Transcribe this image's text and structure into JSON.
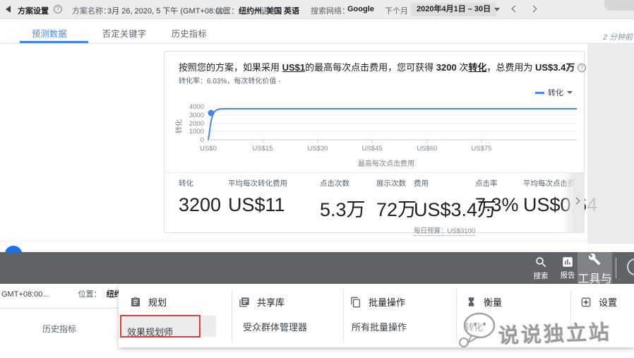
{
  "colors": {
    "accent": "#4285f4",
    "chart_line": "#4285f4",
    "annotation_red": "#e53935",
    "toolbar_bg": "#5f6368"
  },
  "glyphs": {
    "question": "?"
  },
  "topbar": {
    "title": "方案设置",
    "fields": [
      {
        "label": "方案名称：",
        "value": "3月 26, 2020, 5 下午 (GMT+08:00.."
      },
      {
        "label": "位置：",
        "value": "纽约州, 美国"
      },
      {
        "label": "语言：",
        "value": "英语"
      },
      {
        "label": "搜索网络：",
        "value": "Google"
      }
    ],
    "next_month_label": "下个月",
    "date_range": "2020年4月1日 – 30日"
  },
  "tabs": {
    "forecast": "预测数据",
    "negative": "否定关键字",
    "historical": "历史指标"
  },
  "saved_ago": "2 分钟前",
  "card": {
    "headline": [
      "按照您的方案，如果采用 ",
      "US$1",
      "的最高每次点击费用，您可获得 ",
      "3200",
      " 次",
      "转化",
      "，总费用为 ",
      "US$3.4万"
    ],
    "subline": "转化率：6.03%，每次转化价值 -",
    "legend_label": "转化",
    "chart": {
      "type": "line",
      "ylabel": "转化",
      "xlabel": "最高每次点击费用",
      "y_ticks": [
        "4000",
        "3000",
        "2000",
        "1000",
        "0"
      ],
      "x_ticks": [
        "US$0",
        "US$15",
        "US$30",
        "US$45",
        "US$60",
        "US$75"
      ],
      "series": [
        {
          "name": "转化",
          "points_max_cpc_vs_conversions": [
            [
              0,
              0
            ],
            [
              1,
              3200
            ],
            [
              3,
              3750
            ],
            [
              100,
              3750
            ]
          ]
        }
      ],
      "marker": {
        "max_cpc": "US$1",
        "conversions": 3200
      }
    },
    "metrics": [
      {
        "label": "转化",
        "value": "3200"
      },
      {
        "label": "平均每次转化费用",
        "value": "US$11"
      },
      {
        "label": "点击次数",
        "value": "5.3万"
      },
      {
        "label": "展示次数",
        "value": "72万"
      },
      {
        "label": "费用",
        "value": "US$3.4万",
        "sub": "每日预算：US$3100"
      },
      {
        "label": "点击率",
        "value": "7.3%"
      },
      {
        "label": "平均每次点击费用",
        "value": "US$0.6",
        "clipped": "4"
      }
    ]
  },
  "toolbar": {
    "search": "搜索",
    "report": "报告",
    "tools_line1": "工具与",
    "tools_line2": "设置"
  },
  "underlay": {
    "gmt": "GMT+08:00...",
    "location_label": "位置：",
    "location_value": "纽约州, 美",
    "history_tab": "历史指标"
  },
  "menu": {
    "columns": [
      {
        "header": "规划",
        "items": [
          "效果规划师"
        ]
      },
      {
        "header": "共享库",
        "items": [
          "受众群体管理器"
        ]
      },
      {
        "header": "批量操作",
        "items": [
          "所有批量操作"
        ]
      },
      {
        "header": "衡量",
        "items": [
          "转化"
        ]
      },
      {
        "header": "设置",
        "items": []
      }
    ]
  },
  "watermark": {
    "text": "说说独立站"
  }
}
